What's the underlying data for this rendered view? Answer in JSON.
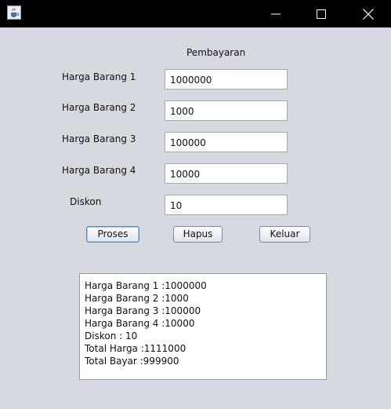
{
  "titlebar": {
    "app_icon": "java-cup-icon",
    "minimize_icon": "minimize-icon",
    "maximize_icon": "maximize-icon",
    "close_icon": "close-icon"
  },
  "form": {
    "title": "Pembayaran",
    "fields": [
      {
        "label": "Harga Barang 1",
        "value": "1000000"
      },
      {
        "label": "Harga Barang 2",
        "value": "1000"
      },
      {
        "label": "Harga Barang 3",
        "value": "100000"
      },
      {
        "label": "Harga Barang 4",
        "value": "10000"
      },
      {
        "label": "Diskon",
        "value": "10"
      }
    ]
  },
  "buttons": {
    "proses": "Proses",
    "hapus": "Hapus",
    "keluar": "Keluar"
  },
  "output": {
    "lines": [
      "Harga Barang 1 :1000000",
      "Harga Barang 2 :1000",
      "Harga Barang 3 :100000",
      "Harga Barang 4 :10000",
      "Diskon : 10",
      "Total Harga :1111000",
      "Total Bayar :999900"
    ]
  }
}
